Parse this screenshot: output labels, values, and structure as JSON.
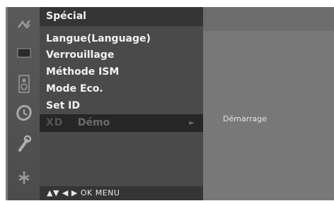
{
  "menu": {
    "title": "Spécial",
    "items": [
      {
        "label": "Langue(Language)"
      },
      {
        "label": "Verrouillage"
      },
      {
        "label": "Méthode ISM"
      },
      {
        "label": "Mode Eco."
      },
      {
        "label": "Set ID"
      },
      {
        "label": "Démo",
        "prefix": "XD"
      }
    ],
    "nav_hint": "▲▼  ◀ ▶  OK  MENU"
  },
  "submenu": {
    "item": "Démarrage"
  },
  "rail": {
    "icons": [
      "tuning-icon",
      "picture-icon",
      "speaker-icon",
      "clock-icon",
      "wrench-icon",
      "network-icon"
    ],
    "selected": "wrench-icon"
  }
}
